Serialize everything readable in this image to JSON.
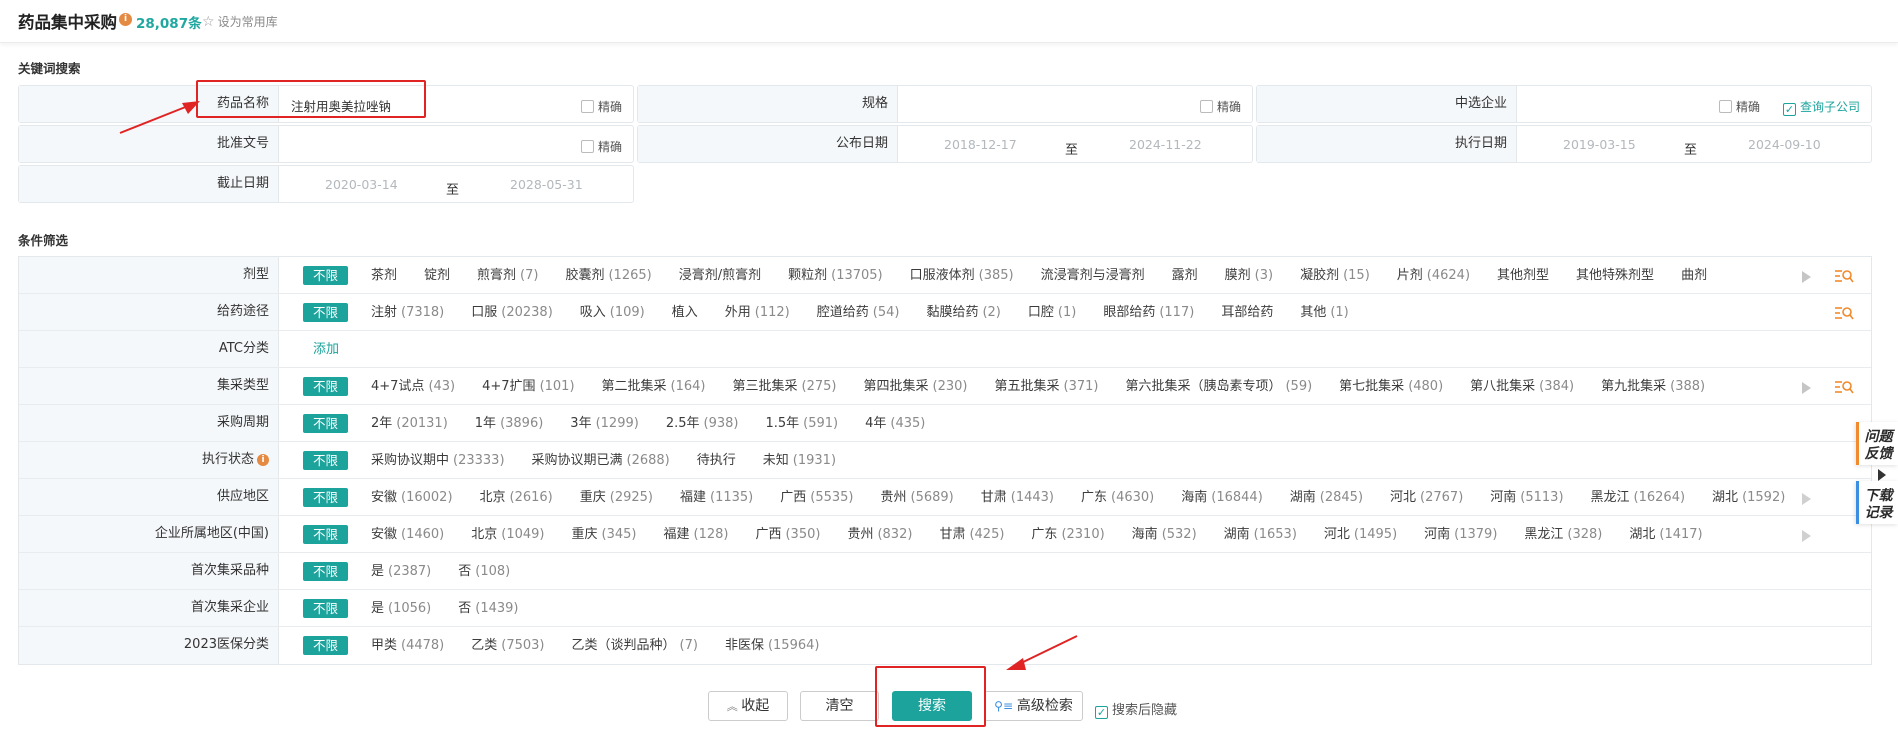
{
  "header": {
    "title": "药品集中采购",
    "count": "28,087条",
    "favorite_label": "设为常用库"
  },
  "keyword_section": {
    "title": "关键词搜索",
    "drug_name": {
      "label": "药品名称",
      "value": "注射用奥美拉唑钠",
      "precise": "精确"
    },
    "spec": {
      "label": "规格",
      "precise": "精确"
    },
    "company": {
      "label": "中选企业",
      "precise": "精确",
      "sub_company": "查询子公司"
    },
    "approval": {
      "label": "批准文号",
      "precise": "精确"
    },
    "publish_date": {
      "label": "公布日期",
      "from": "2018-12-17",
      "to_word": "至",
      "to": "2024-11-22"
    },
    "exec_date": {
      "label": "执行日期",
      "from": "2019-03-15",
      "to_word": "至",
      "to": "2024-09-10"
    },
    "deadline": {
      "label": "截止日期",
      "from": "2020-03-14",
      "to_word": "至",
      "to": "2028-05-31"
    }
  },
  "filter_section": {
    "title": "条件筛选",
    "unlimited": "不限",
    "rows": [
      {
        "label": "剂型",
        "options": [
          [
            "茶剂",
            ""
          ],
          [
            "锭剂",
            ""
          ],
          [
            "煎膏剂",
            "(7)"
          ],
          [
            "胶囊剂",
            "(1265)"
          ],
          [
            "浸膏剂/煎膏剂",
            ""
          ],
          [
            "颗粒剂",
            "(13705)"
          ],
          [
            "口服液体剂",
            "(385)"
          ],
          [
            "流浸膏剂与浸膏剂",
            ""
          ],
          [
            "露剂",
            ""
          ],
          [
            "膜剂",
            "(3)"
          ],
          [
            "凝胶剂",
            "(15)"
          ],
          [
            "片剂",
            "(4624)"
          ],
          [
            "其他剂型",
            ""
          ],
          [
            "其他特殊剂型",
            ""
          ],
          [
            "曲剂",
            ""
          ]
        ]
      },
      {
        "label": "给药途径",
        "options": [
          [
            "注射",
            "(7318)"
          ],
          [
            "口服",
            "(20238)"
          ],
          [
            "吸入",
            "(109)"
          ],
          [
            "植入",
            ""
          ],
          [
            "外用",
            "(112)"
          ],
          [
            "腔道给药",
            "(54)"
          ],
          [
            "黏膜给药",
            "(2)"
          ],
          [
            "口腔",
            "(1)"
          ],
          [
            "眼部给药",
            "(117)"
          ],
          [
            "耳部给药",
            ""
          ],
          [
            "其他",
            "(1)"
          ]
        ]
      },
      {
        "label": "ATC分类",
        "add": "添加"
      },
      {
        "label": "集采类型",
        "options": [
          [
            "4+7试点",
            "(43)"
          ],
          [
            "4+7扩围",
            "(101)"
          ],
          [
            "第二批集采",
            "(164)"
          ],
          [
            "第三批集采",
            "(275)"
          ],
          [
            "第四批集采",
            "(230)"
          ],
          [
            "第五批集采",
            "(371)"
          ],
          [
            "第六批集采（胰岛素专项）",
            "(59)"
          ],
          [
            "第七批集采",
            "(480)"
          ],
          [
            "第八批集采",
            "(384)"
          ],
          [
            "第九批集采",
            "(388)"
          ]
        ]
      },
      {
        "label": "采购周期",
        "options": [
          [
            "2年",
            "(20131)"
          ],
          [
            "1年",
            "(3896)"
          ],
          [
            "3年",
            "(1299)"
          ],
          [
            "2.5年",
            "(938)"
          ],
          [
            "1.5年",
            "(591)"
          ],
          [
            "4年",
            "(435)"
          ]
        ]
      },
      {
        "label": "执行状态",
        "options": [
          [
            "采购协议期中",
            "(23333)"
          ],
          [
            "采购协议期已满",
            "(2688)"
          ],
          [
            "待执行",
            ""
          ],
          [
            "未知",
            "(1931)"
          ]
        ]
      },
      {
        "label": "供应地区",
        "options": [
          [
            "安徽",
            "(16002)"
          ],
          [
            "北京",
            "(2616)"
          ],
          [
            "重庆",
            "(2925)"
          ],
          [
            "福建",
            "(1135)"
          ],
          [
            "广西",
            "(5535)"
          ],
          [
            "贵州",
            "(5689)"
          ],
          [
            "甘肃",
            "(1443)"
          ],
          [
            "广东",
            "(4630)"
          ],
          [
            "海南",
            "(16844)"
          ],
          [
            "湖南",
            "(2845)"
          ],
          [
            "河北",
            "(2767)"
          ],
          [
            "河南",
            "(5113)"
          ],
          [
            "黑龙江",
            "(16264)"
          ],
          [
            "湖北",
            "(1592)"
          ]
        ]
      },
      {
        "label": "企业所属地区(中国)",
        "options": [
          [
            "安徽",
            "(1460)"
          ],
          [
            "北京",
            "(1049)"
          ],
          [
            "重庆",
            "(345)"
          ],
          [
            "福建",
            "(128)"
          ],
          [
            "广西",
            "(350)"
          ],
          [
            "贵州",
            "(832)"
          ],
          [
            "甘肃",
            "(425)"
          ],
          [
            "广东",
            "(2310)"
          ],
          [
            "海南",
            "(532)"
          ],
          [
            "湖南",
            "(1653)"
          ],
          [
            "河北",
            "(1495)"
          ],
          [
            "河南",
            "(1379)"
          ],
          [
            "黑龙江",
            "(328)"
          ],
          [
            "湖北",
            "(1417)"
          ]
        ]
      },
      {
        "label": "首次集采品种",
        "options": [
          [
            "是",
            "(2387)"
          ],
          [
            "否",
            "(108)"
          ]
        ]
      },
      {
        "label": "首次集采企业",
        "options": [
          [
            "是",
            "(1056)"
          ],
          [
            "否",
            "(1439)"
          ]
        ]
      },
      {
        "label": "2023医保分类",
        "options": [
          [
            "甲类",
            "(4478)"
          ],
          [
            "乙类",
            "(7503)"
          ],
          [
            "乙类（谈判品种）",
            "(7)"
          ],
          [
            "非医保",
            "(15964)"
          ]
        ]
      }
    ]
  },
  "actions": {
    "collapse": "收起",
    "clear": "清空",
    "search": "搜索",
    "advanced": "高级检索",
    "hide_after_search": "搜索后隐藏"
  },
  "side": {
    "feedback": "问题反馈",
    "download": "下载记录"
  }
}
